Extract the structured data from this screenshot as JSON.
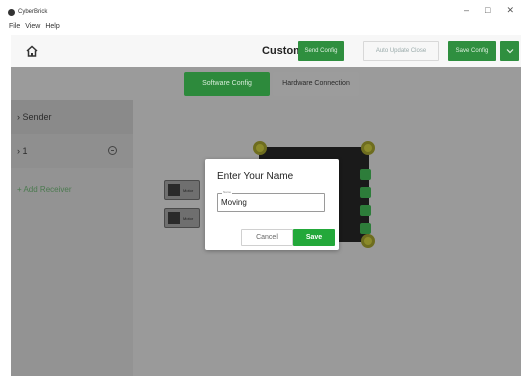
{
  "window": {
    "title": "CyberBrick",
    "controls": [
      "–",
      "□",
      "✕"
    ]
  },
  "menu": [
    "File",
    "View",
    "Help"
  ],
  "header": {
    "title": "Custom",
    "send_config": "Send Config",
    "auto_update_close": "Auto Update Close",
    "save_config": "Save Config",
    "dropdown_icon": "chevron-down-icon"
  },
  "tabs": [
    {
      "label": "Software Config",
      "active": true
    },
    {
      "label": "Hardware Connection",
      "active": false
    }
  ],
  "sidebar": {
    "items": [
      {
        "label": "› Sender"
      },
      {
        "label": "› 1"
      }
    ],
    "add_receiver": "+ Add Receiver"
  },
  "cards": [
    {
      "label": "Motor"
    },
    {
      "label": "Motor"
    }
  ],
  "dialog": {
    "title": "Enter Your Name",
    "input_label": "Name",
    "input_value": "Moving",
    "cancel": "Cancel",
    "save": "Save"
  },
  "colors": {
    "accent": "#2f8f3f",
    "save": "#23a83a"
  }
}
